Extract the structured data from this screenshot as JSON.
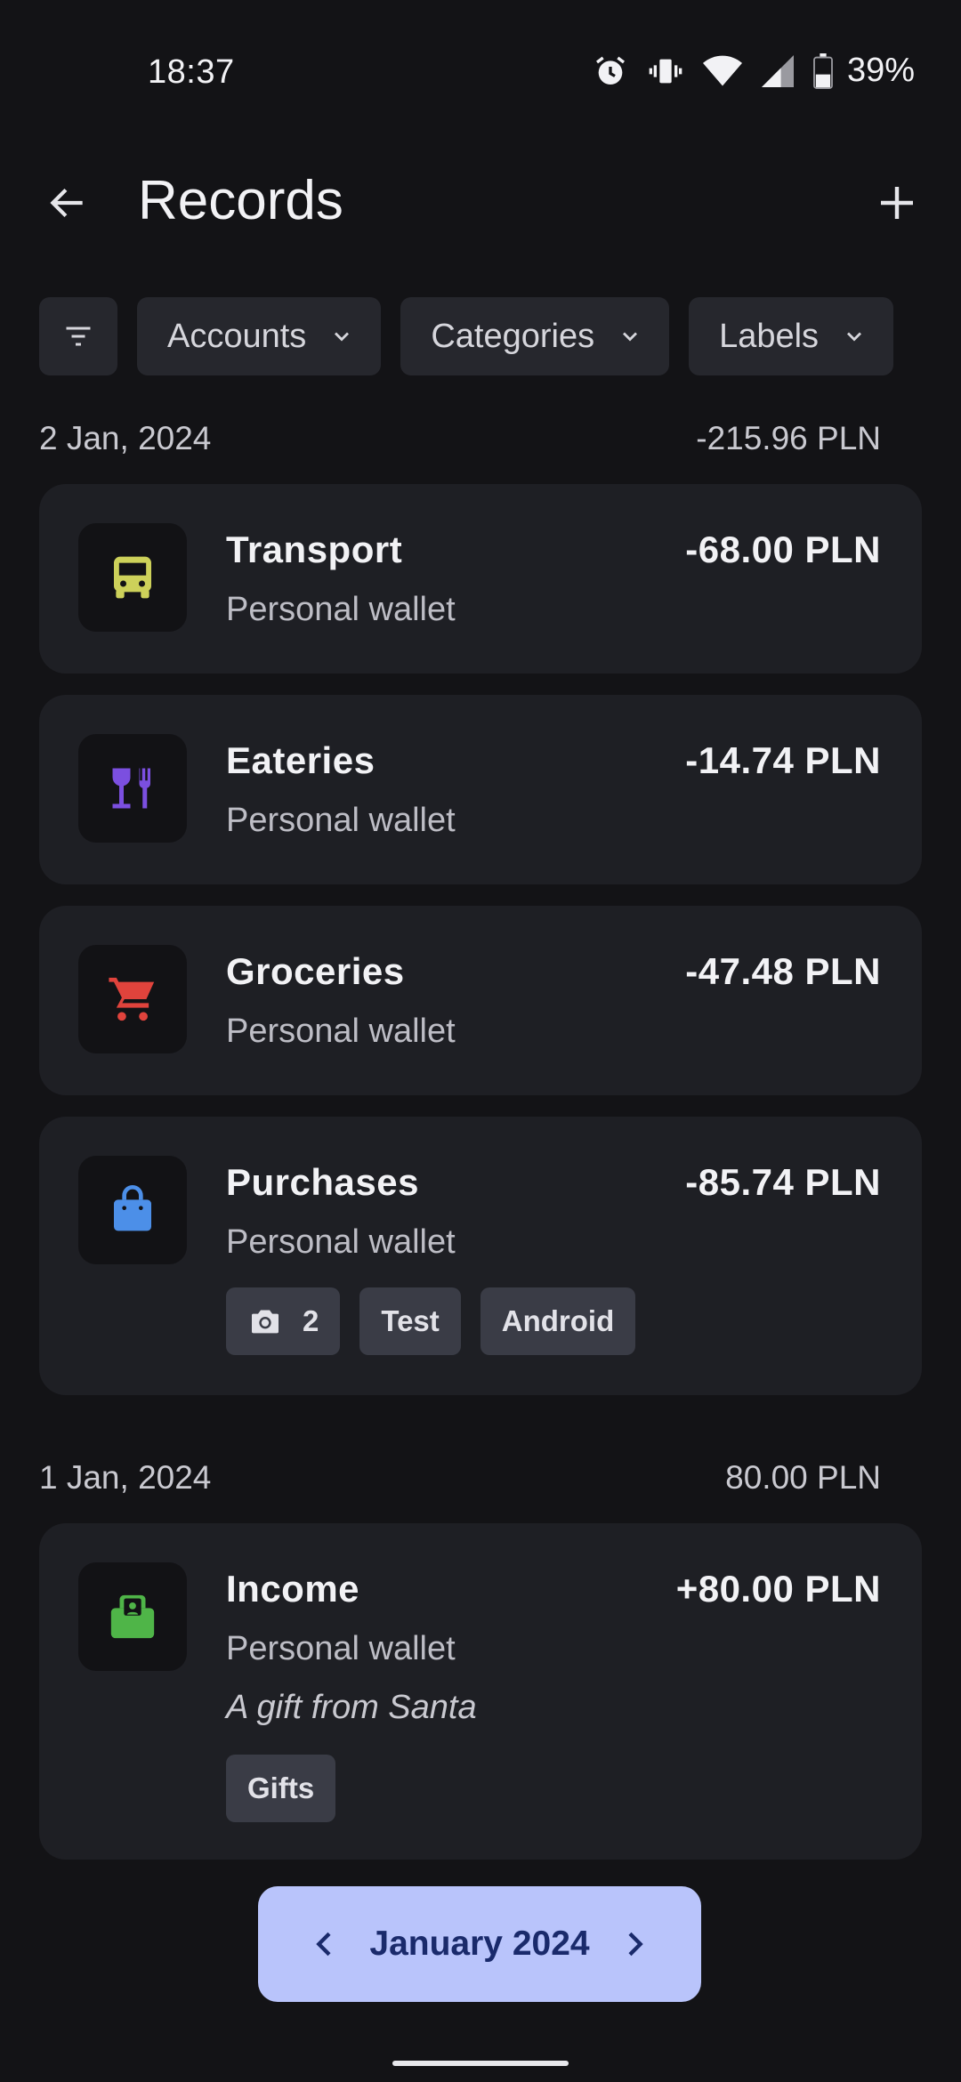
{
  "status_bar": {
    "time": "18:37",
    "battery": "39%"
  },
  "app_bar": {
    "title": "Records"
  },
  "filters": {
    "accounts": "Accounts",
    "categories": "Categories",
    "labels": "Labels"
  },
  "groups": [
    {
      "date": "2 Jan, 2024",
      "total": "-215.96 PLN",
      "records": [
        {
          "category": "Transport",
          "account": "Personal wallet",
          "amount": "-68.00 PLN",
          "icon": "bus-icon",
          "color": "#cdd15a"
        },
        {
          "category": "Eateries",
          "account": "Personal wallet",
          "amount": "-14.74 PLN",
          "icon": "restaurant-icon",
          "color": "#7b4fe0"
        },
        {
          "category": "Groceries",
          "account": "Personal wallet",
          "amount": "-47.48 PLN",
          "icon": "cart-icon",
          "color": "#e0433c"
        },
        {
          "category": "Purchases",
          "account": "Personal wallet",
          "amount": "-85.74 PLN",
          "icon": "shopping-bag-icon",
          "color": "#4c8fe8",
          "tags": {
            "photos": "2",
            "labels": [
              "Test",
              "Android"
            ]
          }
        }
      ]
    },
    {
      "date": "1 Jan, 2024",
      "total": "80.00 PLN",
      "records": [
        {
          "category": "Income",
          "account": "Personal wallet",
          "amount": "+80.00 PLN",
          "icon": "wallet-icon",
          "color": "#4fb548",
          "note": "A gift from Santa",
          "tags": {
            "labels": [
              "Gifts"
            ]
          }
        }
      ]
    }
  ],
  "month_nav": {
    "label": "January 2024"
  }
}
